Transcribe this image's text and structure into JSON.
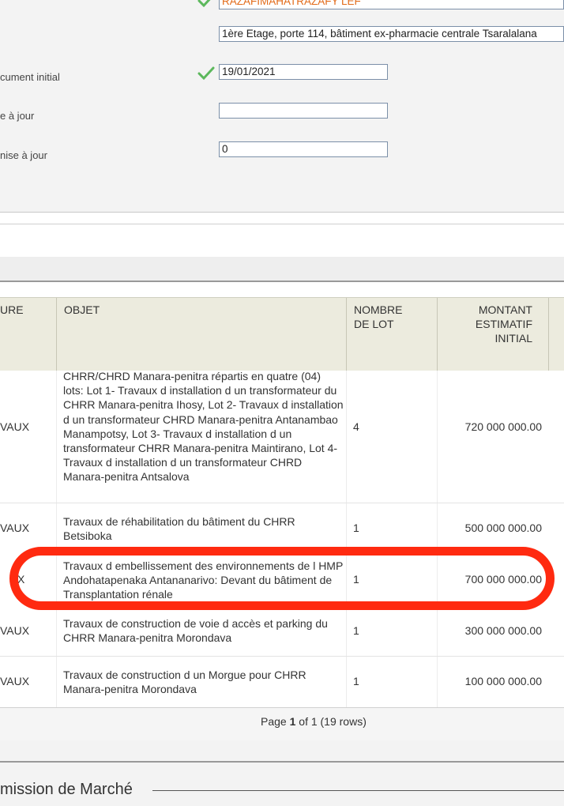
{
  "form": {
    "top_field_value": "RAZAFIMAHATRAZAFY LEF",
    "address_value": "1ère Etage, porte 114, bâtiment ex-pharmacie centrale Tsaralalana",
    "fields": [
      {
        "label": "cument initial",
        "value": "19/01/2021"
      },
      {
        "label": "e à jour",
        "value": ""
      },
      {
        "label": "nise à jour",
        "value": "0"
      }
    ]
  },
  "table": {
    "headers": {
      "nature": "URE",
      "objet": "OBJET",
      "lot_line1": "NOMBRE",
      "lot_line2": "DE LOT",
      "amt_line1": "MONTANT",
      "amt_line2": "ESTIMATIF",
      "amt_line3": "INITIAL"
    },
    "rows": [
      {
        "type": "VAUX",
        "objet": "CHRR/CHRD Manara-penitra répartis en quatre (04) lots: Lot 1- Travaux d installation d un transformateur du CHRR Manara-penitra Ihosy, Lot 2- Travaux d installation d un transformateur CHRD Manara-penitra Antanambao Manampotsy, Lot 3- Travaux d installation d un transformateur CHRR Manara-penitra Maintirano, Lot 4- Travaux d installation d un transformateur CHRD Manara-penitra Antsalova",
        "lot": "4",
        "amount": "720 000 000.00"
      },
      {
        "type": "VAUX",
        "objet": "Travaux de réhabilitation du bâtiment du CHRR Betsiboka",
        "lot": "1",
        "amount": "500 000 000.00"
      },
      {
        "type": "X",
        "objet": "Travaux d embellissement des environnements de l HMP Andohatapenaka Antananarivo: Devant du bâtiment de Transplantation rénale",
        "lot": "1",
        "amount": "700 000 000.00"
      },
      {
        "type": "VAUX",
        "objet": "Travaux de construction de voie d accès et parking du CHRR Manara-penitra Morondava",
        "lot": "1",
        "amount": "300 000 000.00"
      },
      {
        "type": "VAUX",
        "objet": "Travaux de construction d un Morgue pour CHRR Manara-penitra Morondava",
        "lot": "1",
        "amount": "100 000 000.00"
      }
    ]
  },
  "pager": {
    "prefix": "Page ",
    "page": "1",
    "middle": " of 1 (19 rows)"
  },
  "section": {
    "legend": "mission de Marché"
  },
  "colors": {
    "highlight": "#ff2a10",
    "check": "#5cb85c",
    "header_bg": "#ecebde"
  }
}
